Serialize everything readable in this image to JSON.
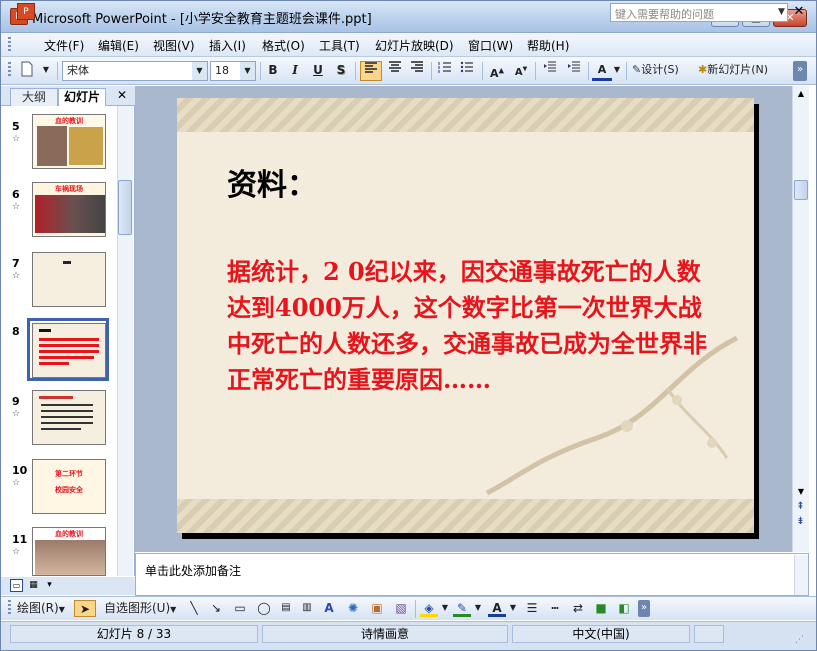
{
  "window": {
    "title": "Microsoft PowerPoint - [小学安全教育主题班会课件.ppt]",
    "app_icon_label": "P",
    "minimize_glyph": "—",
    "maximize_glyph": "□",
    "close_glyph": "✕"
  },
  "menubar": {
    "doc_icon_label": "P",
    "items": [
      "文件(F)",
      "编辑(E)",
      "视图(V)",
      "插入(I)",
      "格式(O)",
      "工具(T)",
      "幻灯片放映(D)",
      "窗口(W)",
      "帮助(H)"
    ],
    "help_placeholder": "键入需要帮助的问题",
    "help_arrow": "▼",
    "close_glyph": "✕"
  },
  "toolbar": {
    "font_name": "宋体",
    "font_size": "18",
    "bold": "B",
    "italic": "I",
    "underline": "U",
    "shadow": "S",
    "design_label": "设计(S)",
    "new_slide_label": "新幻灯片(N)",
    "dropdown_glyph": "▼"
  },
  "left_pane": {
    "tabs": {
      "outline": "大纲",
      "slides": "幻灯片"
    },
    "close_glyph": "✕",
    "star_glyph": "☆",
    "slides": [
      {
        "num": "5",
        "title": "血的教训"
      },
      {
        "num": "6",
        "title": "车祸现场"
      },
      {
        "num": "7",
        "title": "资料"
      },
      {
        "num": "8",
        "title": "资料"
      },
      {
        "num": "9",
        "title": ""
      },
      {
        "num": "10",
        "title": "第二环节",
        "subtitle": "校园安全"
      },
      {
        "num": "11",
        "title": "血的教训"
      }
    ],
    "selected_slide": "8"
  },
  "slide": {
    "heading": "资料：",
    "body": "据统计，2 0纪以来，因交通事故死亡的人数达到4000万人，这个数字比第一次世界大战中死亡的人数还多，交通事故已成为全世界非正常死亡的重要原因……",
    "body_color": "#e8141c"
  },
  "notes": {
    "placeholder": "单击此处添加备注"
  },
  "drawing_toolbar": {
    "draw_label": "绘图(R)",
    "autoshapes_label": "自选图形(U)",
    "dropdown_glyph": "▼"
  },
  "statusbar": {
    "slide_position": "幻灯片 8 / 33",
    "theme": "诗情画意",
    "language": "中文(中国)"
  },
  "colors": {
    "chrome_blue": "#d6e2f2",
    "edit_area": "#a9b8cc",
    "slide_bg": "#f3ecdc",
    "highlight": "#fbd68a"
  }
}
